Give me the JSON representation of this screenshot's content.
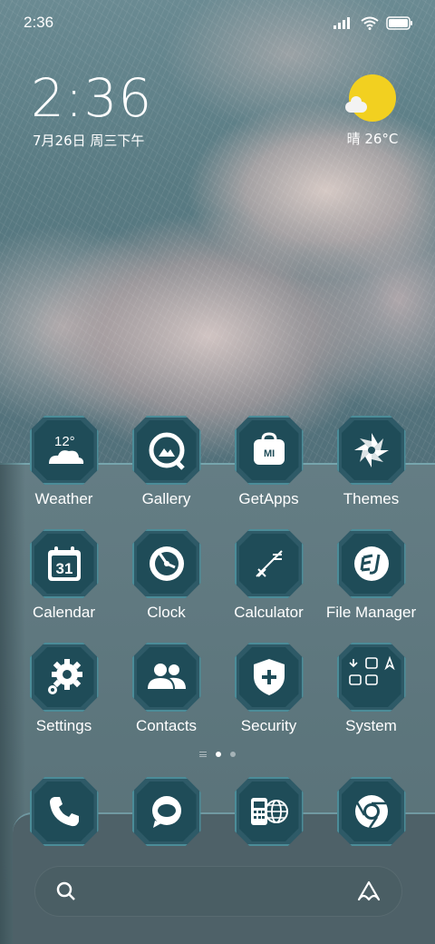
{
  "status_bar": {
    "time": "2:36",
    "icons": [
      "signal-icon",
      "wifi-icon",
      "battery-icon"
    ]
  },
  "clock_widget": {
    "time": "2:36",
    "date": "7月26日 周三下午"
  },
  "weather_widget": {
    "condition_temp": "晴 26°C",
    "icon": "sun-cloud-icon"
  },
  "apps": [
    {
      "label": "Weather",
      "icon": "weather-icon",
      "temp": "12°"
    },
    {
      "label": "Gallery",
      "icon": "gallery-icon"
    },
    {
      "label": "GetApps",
      "icon": "getapps-icon",
      "badge": "MI"
    },
    {
      "label": "Themes",
      "icon": "themes-icon"
    },
    {
      "label": "Calendar",
      "icon": "calendar-icon",
      "day": "31"
    },
    {
      "label": "Clock",
      "icon": "clock-icon"
    },
    {
      "label": "Calculator",
      "icon": "calculator-icon"
    },
    {
      "label": "File Manager",
      "icon": "file-manager-icon"
    },
    {
      "label": "Settings",
      "icon": "settings-icon"
    },
    {
      "label": "Contacts",
      "icon": "contacts-icon"
    },
    {
      "label": "Security",
      "icon": "security-icon"
    },
    {
      "label": "System",
      "icon": "system-folder-icon"
    }
  ],
  "page_indicator": {
    "pages": 2,
    "current": 1
  },
  "dock": [
    {
      "icon": "phone-icon"
    },
    {
      "icon": "messages-icon"
    },
    {
      "icon": "browser-icon"
    },
    {
      "icon": "chrome-icon"
    }
  ],
  "search": {
    "left_icon": "search-icon",
    "right_icon": "assistant-icon"
  },
  "colors": {
    "accent": "#4b8c98",
    "icon_bg": "#1f4c58",
    "sun": "#f2d020",
    "panel": "#5f7a80"
  }
}
